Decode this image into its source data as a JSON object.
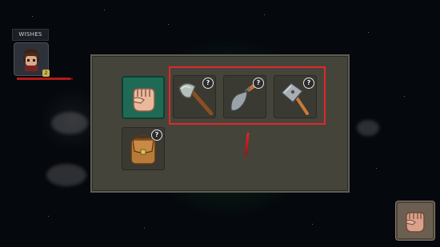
{
  "hud": {
    "wishes_label": "WISHES",
    "character_level": "2",
    "health_fraction": 0.95
  },
  "crafting": {
    "help_mark": "?",
    "slots": [
      {
        "name": "fist",
        "icon": "fist-icon",
        "selected": true,
        "locked": false
      },
      {
        "name": "axe",
        "icon": "axe-icon",
        "selected": false,
        "locked": true
      },
      {
        "name": "trowel",
        "icon": "trowel-icon",
        "selected": false,
        "locked": true
      },
      {
        "name": "hammer",
        "icon": "hammer-icon",
        "selected": false,
        "locked": true
      },
      {
        "name": "satchel",
        "icon": "satchel-icon",
        "selected": false,
        "locked": true
      }
    ]
  },
  "colors": {
    "highlight": "#e0282a",
    "active_slot": "#1f6a55",
    "panel": "#45443a"
  },
  "action_button": {
    "icon": "fist-icon"
  }
}
